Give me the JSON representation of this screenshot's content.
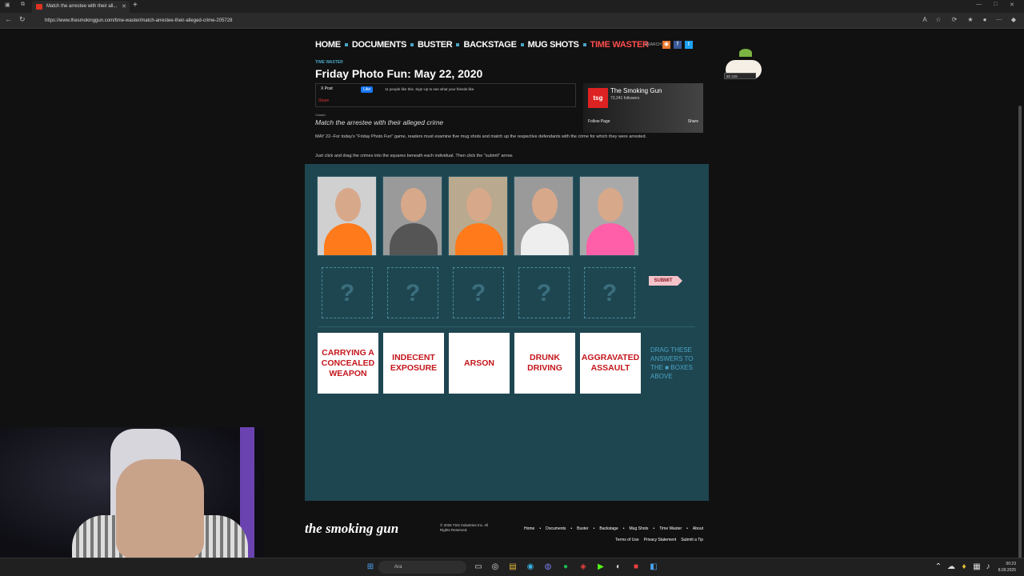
{
  "browser": {
    "tab_title": "Match the arrestee with their all...",
    "url": "https://www.thesmokinggun.com/time-waster/match-arrestee-their-alleged-crime-205728"
  },
  "site_nav": {
    "items": [
      "HOME",
      "DOCUMENTS",
      "BUSTER",
      "BACKSTAGE",
      "MUG SHOTS",
      "TIME WASTER"
    ],
    "active": "TIME WASTER",
    "search_label": "SEARCH"
  },
  "article": {
    "kicker": "TIME WASTER",
    "title": "Friday Photo Fun: May 22, 2020",
    "x_post": "X Post",
    "fb_like": "Like",
    "fb_like_text": "11 people like this. Sign Up to see what your friends like.",
    "share_label": "Share",
    "closed_label": "Closed",
    "subhead": "Match the arrestee with their alleged crime",
    "paragraph_1": "MAY 22--For today's \"Friday Photo Fun\" game, readers must examine five mug shots and match up the respective defendants with the crime for which they were arrested.",
    "paragraph_2": "Just click and drag the crimes into the squares beneath each individual. Then click the \"submit\" arrow."
  },
  "fb_widget": {
    "logo": "tsg",
    "name": "The Smoking Gun",
    "followers": "73,241 followers",
    "follow_label": "Follow Page",
    "share_label": "Share"
  },
  "game": {
    "slot_placeholder": "?",
    "submit_label": "SUBMIT",
    "answers": [
      "CARRYING A CONCEALED WEAPON",
      "INDECENT EXPOSURE",
      "ARSON",
      "DRUNK DRIVING",
      "AGGRAVATED ASSAULT"
    ],
    "drag_note": "DRAG THESE ANSWERS TO THE ■ BOXES ABOVE",
    "mugs": [
      {
        "name": "mugshot-1",
        "shirt": "#ff7a1a",
        "bg": "#d0d0d0"
      },
      {
        "name": "mugshot-2",
        "shirt": "#555555",
        "bg": "#9a9a9a"
      },
      {
        "name": "mugshot-3",
        "shirt": "#ff7a1a",
        "bg": "#b8a98f"
      },
      {
        "name": "mugshot-4",
        "shirt": "#eeeeee",
        "bg": "#9a9a9a"
      },
      {
        "name": "mugshot-5",
        "shirt": "#ff5fa8",
        "bg": "#a9a9a9"
      }
    ]
  },
  "footer": {
    "logo": "the smoking gun",
    "copyright": "© 2025 TSG Industries Inc. All Rights Reserved.",
    "links_row_1": [
      "Home",
      "Documents",
      "Buster",
      "Backstage",
      "Mug Shots",
      "Time Waster",
      "About"
    ],
    "links_row_2": [
      "Terms of Use",
      "Privacy Statement",
      "Submit a Tip"
    ]
  },
  "extension": {
    "count": "60 228"
  },
  "taskbar": {
    "search_text": "Ara",
    "time": "00:23",
    "date": "8.09.2025"
  }
}
